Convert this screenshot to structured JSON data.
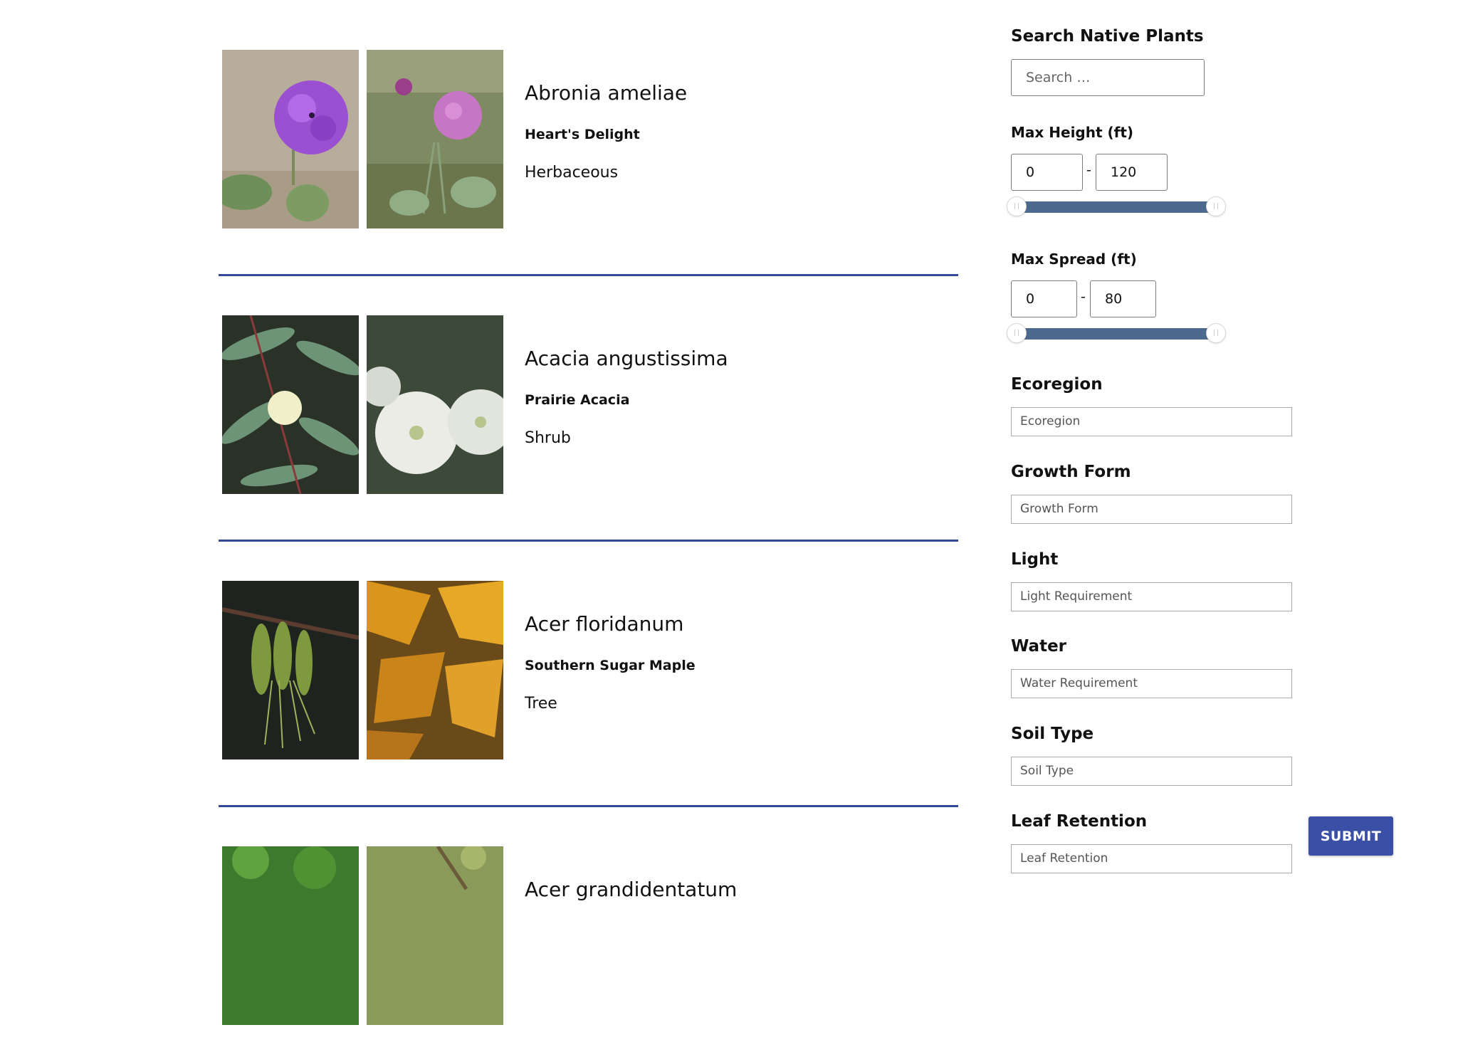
{
  "plants": [
    {
      "scientific_name": "Abronia ameliae",
      "common_name": "Heart's Delight",
      "growth_form": "Herbaceous"
    },
    {
      "scientific_name": "Acacia angustissima",
      "common_name": "Prairie Acacia",
      "growth_form": "Shrub"
    },
    {
      "scientific_name": "Acer floridanum",
      "common_name": "Southern Sugar Maple",
      "growth_form": "Tree"
    },
    {
      "scientific_name": "Acer grandidentatum",
      "common_name": "",
      "growth_form": ""
    }
  ],
  "sidebar": {
    "search_label": "Search Native Plants",
    "search_placeholder": "Search …",
    "height": {
      "label": "Max Height (ft)",
      "min": "0",
      "max": "120",
      "separator": "-",
      "range_min": 0,
      "range_max": 120
    },
    "spread": {
      "label": "Max Spread (ft)",
      "min": "0",
      "max": "80",
      "separator": "-",
      "range_min": 0,
      "range_max": 80
    },
    "ecoregion": {
      "label": "Ecoregion",
      "placeholder": "Ecoregion"
    },
    "growth_form": {
      "label": "Growth Form",
      "placeholder": "Growth Form"
    },
    "light": {
      "label": "Light",
      "placeholder": "Light Requirement"
    },
    "water": {
      "label": "Water",
      "placeholder": "Water Requirement"
    },
    "soil": {
      "label": "Soil Type",
      "placeholder": "Soil Type"
    },
    "leaf": {
      "label": "Leaf Retention",
      "placeholder": "Leaf Retention"
    },
    "submit_label": "SUBMIT"
  },
  "colors": {
    "accent": "#34489a",
    "button": "#3a4fa6",
    "slider": "#4b6a8e"
  }
}
